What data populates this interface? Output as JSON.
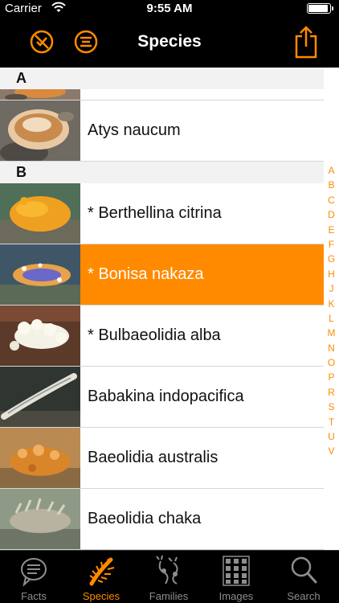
{
  "status_bar": {
    "carrier": "Carrier",
    "time": "9:55 AM"
  },
  "nav": {
    "title": "Species"
  },
  "colors": {
    "accent": "#ff8a00",
    "bar": "#000000",
    "section_bg": "#f2f2f2"
  },
  "sections": [
    {
      "letter": "A",
      "items": [
        {
          "name": ""
        },
        {
          "name": "Atys naucum"
        }
      ]
    },
    {
      "letter": "B",
      "items": [
        {
          "name": "* Berthellina citrina"
        },
        {
          "name": "* Bonisa nakaza",
          "selected": true
        },
        {
          "name": "* Bulbaeolidia alba"
        },
        {
          "name": "Babakina indopacifica"
        },
        {
          "name": "Baeolidia australis"
        },
        {
          "name": "Baeolidia chaka"
        }
      ]
    }
  ],
  "index": [
    "A",
    "B",
    "C",
    "D",
    "E",
    "F",
    "G",
    "H",
    "J",
    "K",
    "L",
    "M",
    "N",
    "O",
    "P",
    "R",
    "S",
    "T",
    "U",
    "V"
  ],
  "tabs": [
    {
      "label": "Facts",
      "icon": "speech-bubble-icon"
    },
    {
      "label": "Species",
      "icon": "nudibranch-icon",
      "active": true
    },
    {
      "label": "Families",
      "icon": "families-icon"
    },
    {
      "label": "Images",
      "icon": "grid-icon"
    },
    {
      "label": "Search",
      "icon": "magnifier-icon"
    }
  ]
}
